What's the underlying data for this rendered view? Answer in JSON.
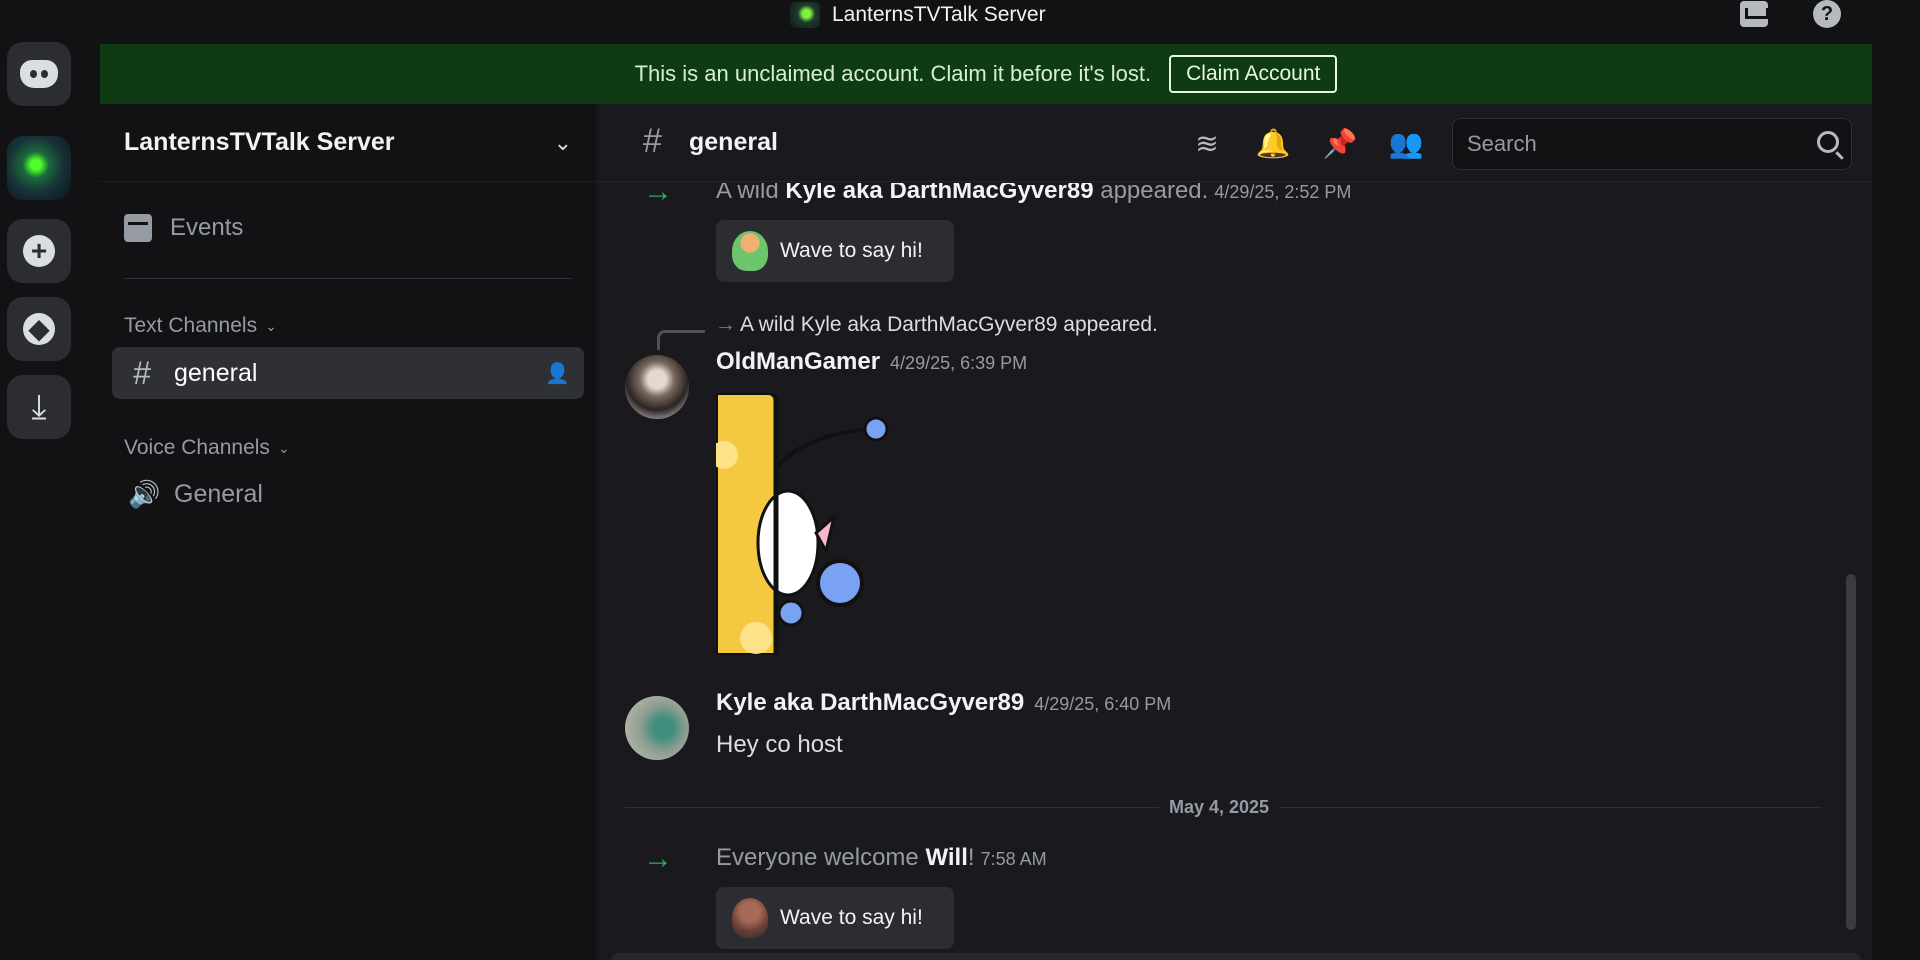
{
  "window": {
    "title": "LanternsTVTalk Server"
  },
  "banner": {
    "text": "This is an unclaimed account. Claim it before it's lost.",
    "button": "Claim Account"
  },
  "server": {
    "name": "LanternsTVTalk Server"
  },
  "sidebar": {
    "events": "Events",
    "text_category": "Text Channels",
    "voice_category": "Voice Channels",
    "text_channels": [
      {
        "name": "general"
      }
    ],
    "voice_channels": [
      {
        "name": "General"
      }
    ]
  },
  "channel": {
    "name": "general"
  },
  "search": {
    "placeholder": "Search"
  },
  "messages": {
    "join1": {
      "prefix": "A wild ",
      "user": "Kyle aka DarthMacGyver89",
      "suffix": " appeared.",
      "time": "4/29/25, 2:52 PM"
    },
    "wave_label": "Wave to say hi!",
    "reply_preview": "A wild Kyle aka DarthMacGyver89 appeared.",
    "msg1": {
      "user": "OldManGamer",
      "time": "4/29/25, 6:39 PM"
    },
    "msg2": {
      "user": "Kyle aka DarthMacGyver89",
      "time": "4/29/25, 6:40 PM",
      "text": "Hey co host"
    },
    "date_divider": "May 4, 2025",
    "join2": {
      "prefix": "Everyone welcome ",
      "user": "Will",
      "suffix": "!",
      "time": "7:58 AM"
    }
  },
  "icons": [
    "discord-icon",
    "add-server-icon",
    "explore-icon",
    "download-icon",
    "inbox-icon",
    "help-icon",
    "calendar-icon",
    "hash-icon",
    "speaker-icon",
    "threads-icon",
    "bell-icon",
    "pin-icon",
    "members-icon",
    "search-icon"
  ],
  "colors": {
    "banner_bg": "#0f3b14",
    "join_arrow": "#3ba55c",
    "app_bg": "#121214",
    "chat_bg": "#1a1a1e"
  }
}
